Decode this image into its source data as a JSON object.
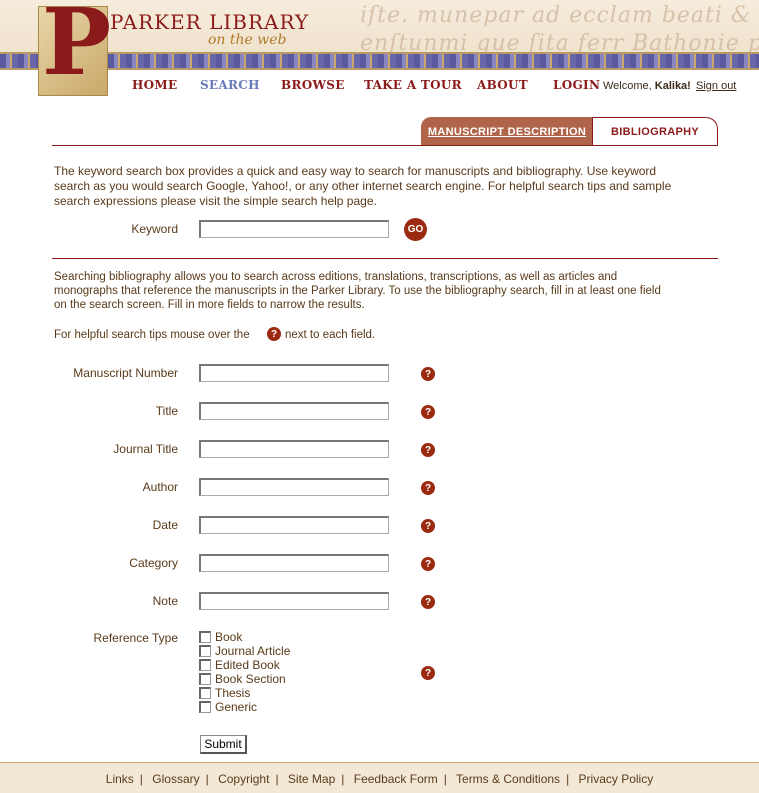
{
  "header": {
    "title": "PARKER LIBRARY",
    "subtitle": "on the web",
    "logo_letter": "P",
    "banner_text": "iſte. munepar ad ecclam beati & pſati gecls\nenſtunmi que ſita ferr Bathonie pcordal"
  },
  "nav": {
    "items": [
      {
        "label": "HOME",
        "active": false
      },
      {
        "label": "SEARCH",
        "active": true
      },
      {
        "label": "BROWSE",
        "active": false
      },
      {
        "label": "TAKE A TOUR",
        "active": false
      },
      {
        "label": "ABOUT",
        "active": false
      },
      {
        "label": "LOGIN",
        "active": false
      }
    ],
    "welcome_prefix": "Welcome,",
    "user_name": "Kalika!",
    "sign_out": "Sign out"
  },
  "tabs": {
    "manuscript_description": "MANUSCRIPT DESCRIPTION",
    "bibliography": "BIBLIOGRAPHY"
  },
  "keyword_section": {
    "intro": "The keyword search box provides a quick and easy way to search for manuscripts and bibliography. Use keyword search as you would search Google, Yahoo!, or any other internet search engine. For helpful search tips and sample search expressions please visit the simple search help page.",
    "label": "Keyword",
    "value": "",
    "go_label": "GO"
  },
  "bibliography_section": {
    "intro": "Searching bibliography allows you to search across editions, translations, transcriptions, as well as articles and monographs that reference the manuscripts in the Parker Library. To use the bibliography search, fill in at least one field on the search screen. Fill in more fields to narrow the results.",
    "tip_prefix": "For helpful search tips mouse over the",
    "tip_suffix": "next to each field.",
    "help_glyph": "?",
    "fields": [
      {
        "label": "Manuscript Number",
        "value": ""
      },
      {
        "label": "Title",
        "value": ""
      },
      {
        "label": "Journal Title",
        "value": ""
      },
      {
        "label": "Author",
        "value": ""
      },
      {
        "label": "Date",
        "value": ""
      },
      {
        "label": "Category",
        "value": ""
      },
      {
        "label": "Note",
        "value": ""
      }
    ],
    "reference_type_label": "Reference Type",
    "reference_types": [
      {
        "label": "Book",
        "checked": false
      },
      {
        "label": "Journal Article",
        "checked": false
      },
      {
        "label": "Edited Book",
        "checked": false
      },
      {
        "label": "Book Section",
        "checked": false
      },
      {
        "label": "Thesis",
        "checked": false
      },
      {
        "label": "Generic",
        "checked": false
      }
    ],
    "submit_label": "Submit"
  },
  "footer": {
    "links": [
      "Links",
      "Glossary",
      "Copyright",
      "Site Map",
      "Feedback Form",
      "Terms & Conditions",
      "Privacy Policy"
    ],
    "separator": "|"
  },
  "colors": {
    "brand_red": "#8b1a1a",
    "active_nav": "#6a7ab8",
    "tab_active_bg": "#b0654a",
    "help_icon": "#9b2a10"
  }
}
